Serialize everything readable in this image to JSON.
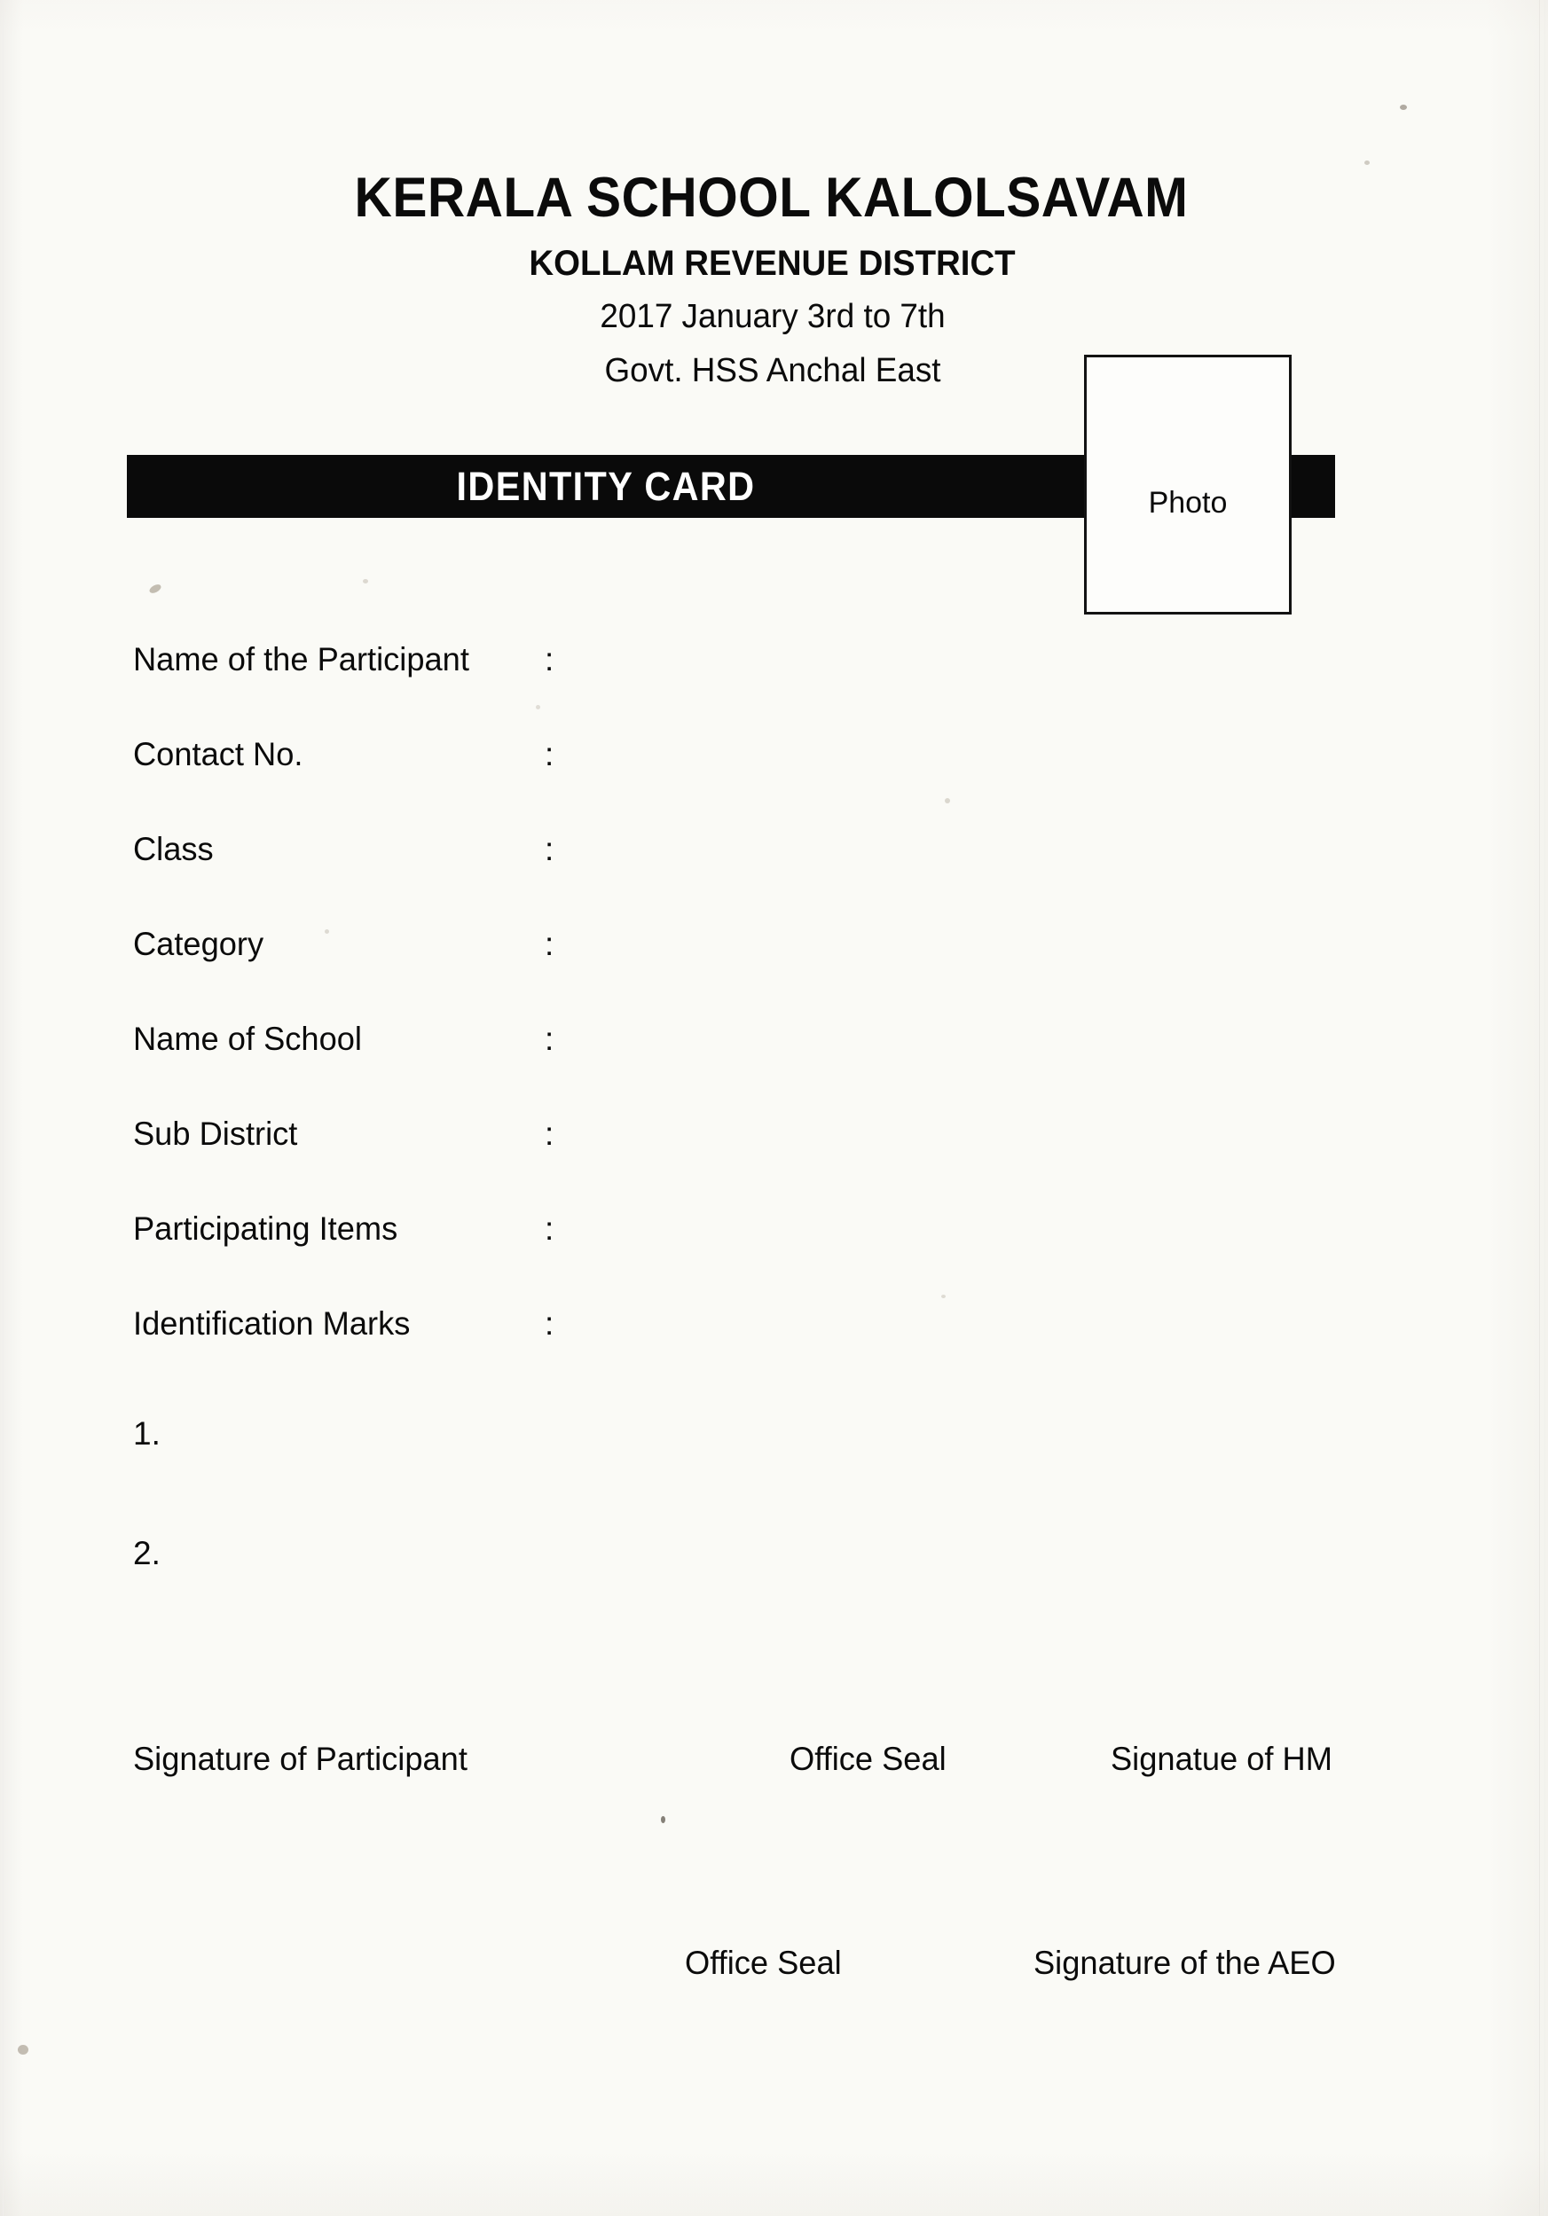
{
  "header": {
    "main_title": "KERALA SCHOOL KALOLSAVAM",
    "sub_title": "KOLLAM REVENUE DISTRICT",
    "date_line": "2017 January 3rd to 7th",
    "venue_line": "Govt. HSS Anchal East"
  },
  "banner": {
    "label": "IDENTITY CARD",
    "background_color": "#0a0a0a",
    "text_color": "#ffffff"
  },
  "photo": {
    "label": "Photo"
  },
  "fields": [
    {
      "label": "Name of the Participant",
      "colon": ":",
      "value": ""
    },
    {
      "label": "Contact No.",
      "colon": ":",
      "value": ""
    },
    {
      "label": "Class",
      "colon": ":",
      "value": ""
    },
    {
      "label": "Category",
      "colon": ":",
      "value": ""
    },
    {
      "label": "Name of School",
      "colon": ":",
      "value": ""
    },
    {
      "label": "Sub District",
      "colon": ":",
      "value": ""
    },
    {
      "label": "Participating Items",
      "colon": ":",
      "value": ""
    },
    {
      "label": "Identification Marks",
      "colon": ":",
      "value": ""
    }
  ],
  "numbered_items": [
    {
      "marker": "1.",
      "value": ""
    },
    {
      "marker": "2.",
      "value": ""
    }
  ],
  "signatures": {
    "row1": {
      "participant": "Signature of Participant",
      "office_seal": "Office Seal",
      "hm": "Signatue of HM"
    },
    "row2": {
      "office_seal": "Office Seal",
      "aeo": "Signature of the AEO"
    }
  }
}
